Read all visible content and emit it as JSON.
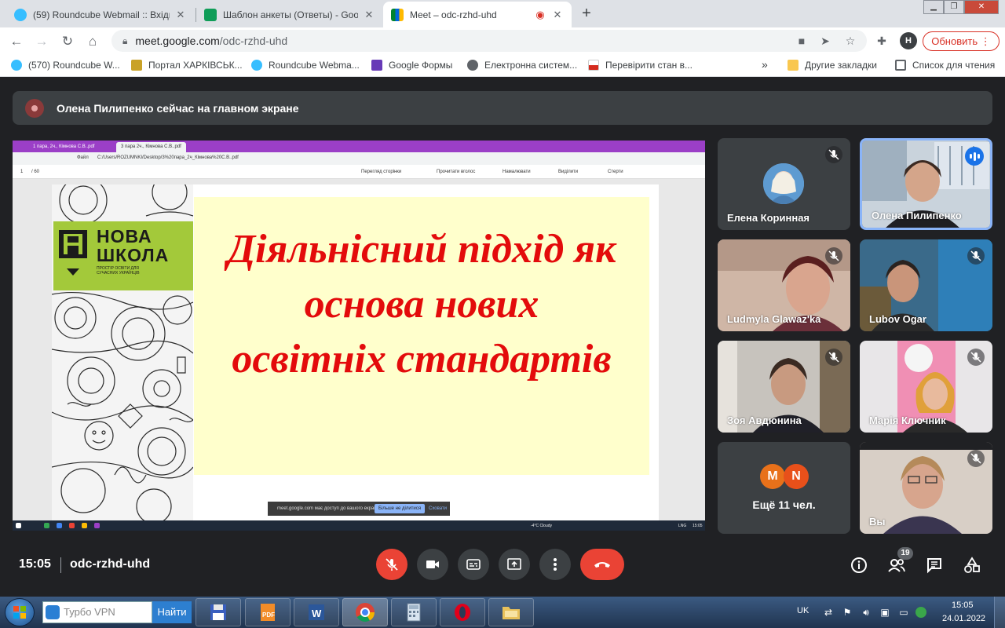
{
  "browser": {
    "tabs": [
      {
        "title": "(59) Roundcube Webmail :: Вхідн",
        "active": false
      },
      {
        "title": "Шаблон анкеты (Ответы) - Goog",
        "active": false
      },
      {
        "title": "Meet – odc-rzhd-uhd",
        "active": true
      }
    ],
    "url_domain": "meet.google.com",
    "url_path": "/odc-rzhd-uhd",
    "profile_initial": "H",
    "update_label": "Обновить",
    "bookmarks": [
      "(570) Roundcube W...",
      "Портал ХАРКІВСЬК...",
      "Roundcube Webma...",
      "Google Формы",
      "Електронна систем...",
      "Перевірити стан в..."
    ],
    "bookmarks_overflow": "»",
    "other_bookmarks": "Другие закладки",
    "reading_list": "Список для чтения"
  },
  "meet": {
    "presenter_banner": "Олена Пилипенко сейчас на главном экране",
    "shared_screen": {
      "pdf_tabs": [
        "1 пара, 2ч., Кімнова С.В..pdf",
        "3 пара 2ч., Кімнова С.В..pdf"
      ],
      "pdf_path_label": "Файл",
      "pdf_path": "C:/Users/ROZUMNKI/Desktop/3%20пара_2ч_Кімнова%20С.В..pdf",
      "page_num": "1",
      "page_total": "/ 60",
      "tools": [
        "Перегляд сторінки",
        "Прочитати вголос",
        "Намалювати",
        "Виділити",
        "Стерти"
      ],
      "logo_line1": "НОВА",
      "logo_line2": "ШКОЛА",
      "logo_small": "ПРОСТІР ОСВІТИ ДЛЯ СУЧАСНИХ УКРАЇНЦІВ",
      "slide_title_lines": [
        "Діяльнісний підхід як",
        "основа нових",
        "освітніх стандартів"
      ],
      "share_notice": "meet.google.com має доступ до вашого екрана.",
      "share_stop": "Більше не ділитися",
      "share_hide": "Сховати",
      "inner_weather": "-4°C Cloudy",
      "inner_lang": "LNG",
      "inner_time": "15:05"
    },
    "participants": [
      {
        "name": "Елена Коринная",
        "muted": true,
        "speaking": false
      },
      {
        "name": "Олена Пилипенко",
        "muted": false,
        "speaking": true
      },
      {
        "name": "Ludmyla Glawaz'ka",
        "muted": true,
        "speaking": false
      },
      {
        "name": "Lubov Ogar",
        "muted": true,
        "speaking": false
      },
      {
        "name": "Зоя Авдюнина",
        "muted": true,
        "speaking": false
      },
      {
        "name": "Марія Ключник",
        "muted": true,
        "speaking": false
      },
      {
        "name": "Вы",
        "muted": true,
        "speaking": false
      }
    ],
    "more_participants": {
      "initials": [
        "M",
        "N"
      ],
      "label": "Ещё 11 чел."
    },
    "time": "15:05",
    "meeting_code": "odc-rzhd-uhd",
    "people_count": "19",
    "colors": {
      "accent_red": "#ea4335",
      "speaking_blue": "#1a73e8",
      "tile_bg": "#3c4043"
    }
  },
  "taskbar": {
    "search_text": "Турбо VPN",
    "search_button": "Найти",
    "lang": "UK",
    "clock_time": "15:05",
    "clock_date": "24.01.2022"
  }
}
